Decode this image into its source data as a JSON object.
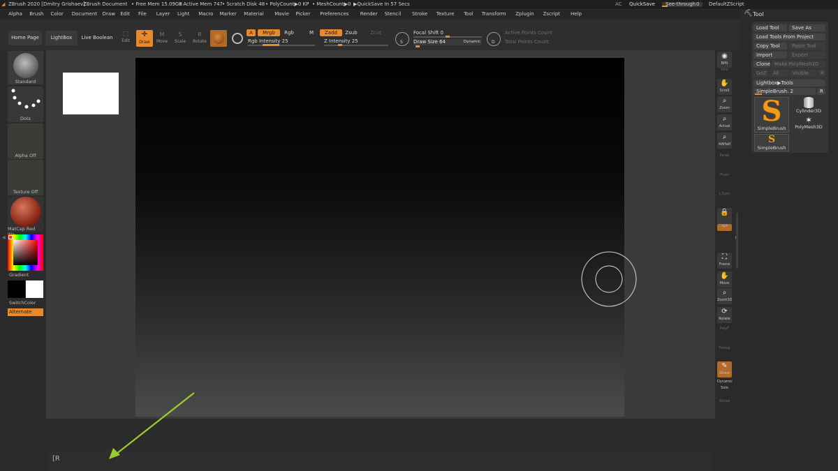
{
  "title_bar": {
    "app": "ZBrush 2020 [Dmitry Grishaev]",
    "document": "ZBrush Document",
    "free_mem": "• Free Mem 15.09GB",
    "active_mem": "• Active Mem 747",
    "scratch": "• Scratch Disk 48",
    "polycount": "• PolyCount▶0 KP",
    "meshcount": "• MeshCount▶0",
    "quicksave_status": "▶QuickSave In 57 Secs",
    "ac": "AC",
    "quicksave": "QuickSave",
    "see_through_label": "See-through",
    "see_through_value": "0",
    "see_through_fraction": 0.0,
    "script": "DefaultZScript"
  },
  "menu": [
    "Alpha",
    "Brush",
    "Color",
    "Document",
    "Draw",
    "Edit",
    "File",
    "Layer",
    "Light",
    "Macro",
    "Marker",
    "Material",
    "Movie",
    "Picker",
    "Preferences",
    "Render",
    "Stencil",
    "Stroke",
    "Texture",
    "Tool",
    "Transform",
    "Zplugin",
    "Zscript",
    "Help"
  ],
  "toolbar": {
    "home_page": "Home Page",
    "lightbox": "LightBox",
    "live_boolean": "Live Boolean",
    "edit": "Edit",
    "draw": "Draw",
    "move": "Move",
    "scale": "Scale",
    "rotate": "Rotate",
    "a": "A",
    "mrgb": "Mrgb",
    "rgb": "Rgb",
    "m": "M",
    "zadd": "Zadd",
    "zsub": "Zsub",
    "zcut": "Zcut",
    "rgb_intensity": "Rgb Intensity 25",
    "rgb_intensity_value": 25,
    "z_intensity": "Z Intensity 25",
    "z_intensity_value": 25,
    "focal_shift": "Focal Shift 0",
    "focal_shift_value": 0,
    "draw_size": "Draw Size 64",
    "draw_size_value": 64,
    "dynamic": "Dynamic",
    "s_letter": "S",
    "d_letter": "D",
    "active_points": "Active Points Count",
    "total_points": "Total Points Count"
  },
  "left_panel": {
    "standard": "Standard",
    "dots": "Dots",
    "alpha_off": "Alpha Off",
    "texture_off": "Texture Off",
    "matcap": "MatCap Red Wa",
    "gradient": "Gradient",
    "switch_color": "SwitchColor",
    "alternate": "Alternate"
  },
  "right_shelf": [
    {
      "name": "bpr",
      "label": "BPR",
      "icon": "bpr-icon",
      "dim": false
    },
    {
      "name": "spix",
      "label": "SPix",
      "icon": "",
      "dim": true
    },
    {
      "name": "scroll",
      "label": "Scroll",
      "icon": "hand-icon",
      "dim": false
    },
    {
      "name": "zoom",
      "label": "Zoom",
      "icon": "zoom-icon",
      "dim": false
    },
    {
      "name": "actual",
      "label": "Actual",
      "icon": "zoom-actual-icon",
      "dim": false
    },
    {
      "name": "aahalf",
      "label": "AAHalf",
      "icon": "zoom-half-icon",
      "dim": false
    },
    {
      "name": "persp",
      "label": "Persp",
      "icon": "",
      "dim": true
    },
    {
      "name": "floor",
      "label": "Floor",
      "icon": "",
      "dim": true
    },
    {
      "name": "lsym",
      "label": "L.Sym",
      "icon": "",
      "dim": true
    },
    {
      "name": "lock",
      "label": "",
      "icon": "lock-icon",
      "dim": false
    },
    {
      "name": "xyz",
      "label": "xyz",
      "icon": "",
      "dim": false
    },
    {
      "name": "frame",
      "label": "Frame",
      "icon": "frame-icon",
      "dim": false
    },
    {
      "name": "move",
      "label": "Move",
      "icon": "hand-icon",
      "dim": false
    },
    {
      "name": "zoom3d",
      "label": "Zoom3D",
      "icon": "zoom3d-icon",
      "dim": false
    },
    {
      "name": "rotate",
      "label": "Rotate",
      "icon": "rotate-icon",
      "dim": false
    },
    {
      "name": "polyf",
      "label": "PolyF",
      "icon": "",
      "dim": true
    },
    {
      "name": "transp",
      "label": "Transp",
      "icon": "",
      "dim": true
    },
    {
      "name": "ghost",
      "label": "Ghost",
      "icon": "ghost-icon",
      "dim": false
    },
    {
      "name": "dynamic",
      "label": "Dynamic",
      "icon": "",
      "dim": false
    },
    {
      "name": "solo",
      "label": "Solo",
      "icon": "",
      "dim": false
    },
    {
      "name": "xpose",
      "label": "Xpose",
      "icon": "",
      "dim": true
    }
  ],
  "tool_palette": {
    "title": "Tool",
    "load_tool": "Load Tool",
    "save_as": "Save As",
    "load_from_project": "Load Tools From Project",
    "copy_tool": "Copy Tool",
    "paste_tool": "Paste Tool",
    "import": "Import",
    "export": "Export",
    "clone": "Clone",
    "make_polymesh": "Make PolyMesh3D",
    "goz": "GoZ",
    "all": "All",
    "visible": "Visible",
    "r": "R",
    "lightbox_tools": "Lightbox▶Tools",
    "current_tool": "SimpleBrush. 2",
    "r2": "R",
    "tool_simplebrush": "SimpleBrush",
    "tool_cylinder": "Cylinder3D",
    "tool_polymesh": "PolyMesh3D",
    "tool_simplebrush2": "SimpleBrush"
  },
  "note": {
    "text": "[R"
  },
  "colors": {
    "accent": "#e8892c",
    "arrow": "#9acd32"
  }
}
